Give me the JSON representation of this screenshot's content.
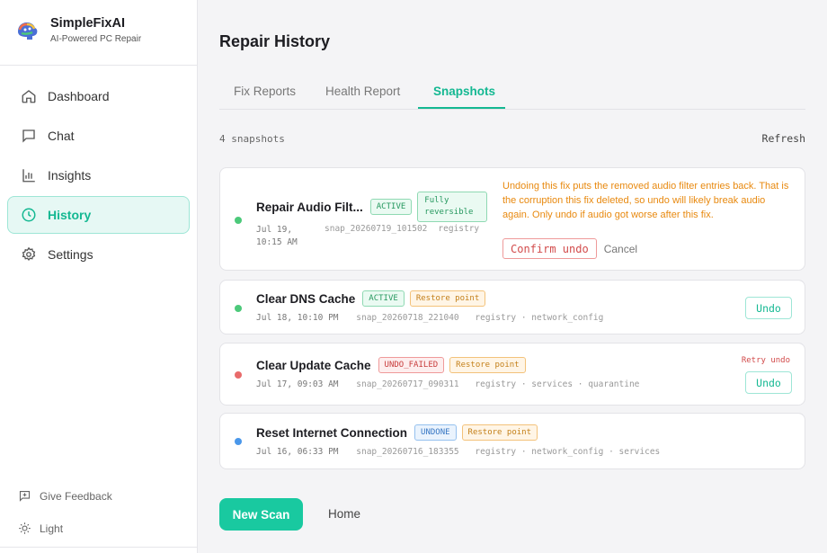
{
  "app": {
    "name": "SimpleFixAI",
    "tagline": "AI-Powered PC Repair"
  },
  "nav": [
    {
      "label": "Dashboard",
      "icon": "home-icon"
    },
    {
      "label": "Chat",
      "icon": "chat-icon"
    },
    {
      "label": "Insights",
      "icon": "bar-chart-icon"
    },
    {
      "label": "History",
      "icon": "clock-icon",
      "active": true
    },
    {
      "label": "Settings",
      "icon": "gear-icon"
    }
  ],
  "sidebar_bottom": {
    "feedback": "Give Feedback",
    "theme": "Light"
  },
  "page": {
    "title": "Repair History"
  },
  "tabs": [
    {
      "label": "Fix Reports"
    },
    {
      "label": "Health Report"
    },
    {
      "label": "Snapshots",
      "active": true
    }
  ],
  "snapshots_header": {
    "count": "4 snapshots",
    "refresh": "Refresh"
  },
  "snapshots": [
    {
      "title": "Repair Audio Filt...",
      "badges": [
        "ACTIVE",
        "Fully reversible"
      ],
      "time": "Jul 19, 10:15 AM",
      "id": "snap_20260719_101502",
      "tags": "registry",
      "status_color": "#4cc97a",
      "warning": "Undoing this fix puts the removed audio filter entries back. That is the corruption this fix deleted, so undo will likely break audio again. Only undo if audio got worse after this fix.",
      "confirm_label": "Confirm undo",
      "cancel_label": "Cancel"
    },
    {
      "title": "Clear DNS Cache",
      "badges": [
        "ACTIVE",
        "Restore point"
      ],
      "time": "Jul 18, 10:10 PM",
      "id": "snap_20260718_221040",
      "tags": "registry · network_config",
      "status_color": "#4cc97a",
      "action_label": "Undo"
    },
    {
      "title": "Clear Update Cache",
      "badges": [
        "UNDO_FAILED",
        "Restore point"
      ],
      "time": "Jul 17, 09:03 AM",
      "id": "snap_20260717_090311",
      "tags": "registry · services · quarantine",
      "status_color": "#e86b6b",
      "retry_label": "Retry undo",
      "action_label": "Undo"
    },
    {
      "title": "Reset Internet Connection",
      "badges": [
        "UNDONE",
        "Restore point"
      ],
      "time": "Jul 16, 06:33 PM",
      "id": "snap_20260716_183355",
      "tags": "registry · network_config · services",
      "status_color": "#4a97ea"
    }
  ],
  "footer": {
    "new_scan": "New Scan",
    "home": "Home"
  },
  "colors": {
    "accent": "#14b892",
    "warning": "#e8890f",
    "danger": "#d24b4b"
  }
}
